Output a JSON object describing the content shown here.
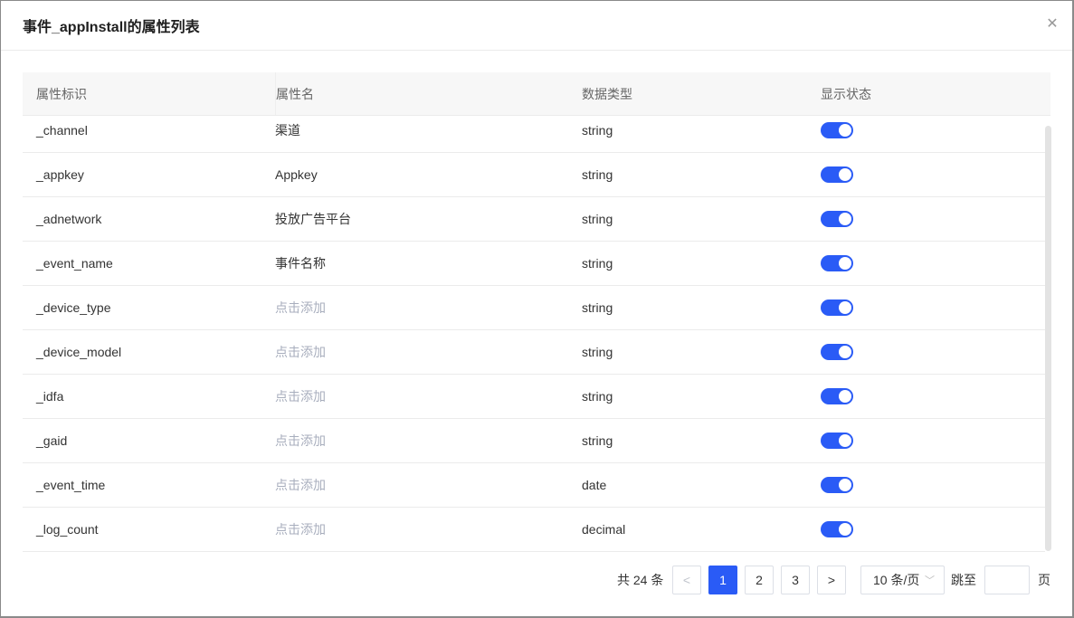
{
  "dialog": {
    "title": "事件_appInstall的属性列表",
    "close_icon": "close-icon"
  },
  "table": {
    "headers": [
      "属性标识",
      "属性名",
      "数据类型",
      "显示状态"
    ],
    "rows": [
      {
        "id": "_channel",
        "name": "渠道",
        "name_placeholder": false,
        "type": "string",
        "enabled": true
      },
      {
        "id": "_appkey",
        "name": "Appkey",
        "name_placeholder": false,
        "type": "string",
        "enabled": true
      },
      {
        "id": "_adnetwork",
        "name": "投放广告平台",
        "name_placeholder": false,
        "type": "string",
        "enabled": true
      },
      {
        "id": "_event_name",
        "name": "事件名称",
        "name_placeholder": false,
        "type": "string",
        "enabled": true
      },
      {
        "id": "_device_type",
        "name": "点击添加",
        "name_placeholder": true,
        "type": "string",
        "enabled": true
      },
      {
        "id": "_device_model",
        "name": "点击添加",
        "name_placeholder": true,
        "type": "string",
        "enabled": true
      },
      {
        "id": "_idfa",
        "name": "点击添加",
        "name_placeholder": true,
        "type": "string",
        "enabled": true
      },
      {
        "id": "_gaid",
        "name": "点击添加",
        "name_placeholder": true,
        "type": "string",
        "enabled": true
      },
      {
        "id": "_event_time",
        "name": "点击添加",
        "name_placeholder": true,
        "type": "date",
        "enabled": true
      },
      {
        "id": "_log_count",
        "name": "点击添加",
        "name_placeholder": true,
        "type": "decimal",
        "enabled": true
      }
    ]
  },
  "pagination": {
    "total_label": "共 24 条",
    "prev": "<",
    "next": ">",
    "pages": [
      "1",
      "2",
      "3"
    ],
    "current": "1",
    "page_size": "10 条/页",
    "jump_label": "跳至",
    "page_suffix": "页",
    "jump_value": ""
  },
  "colors": {
    "accent": "#2a5bf6"
  }
}
